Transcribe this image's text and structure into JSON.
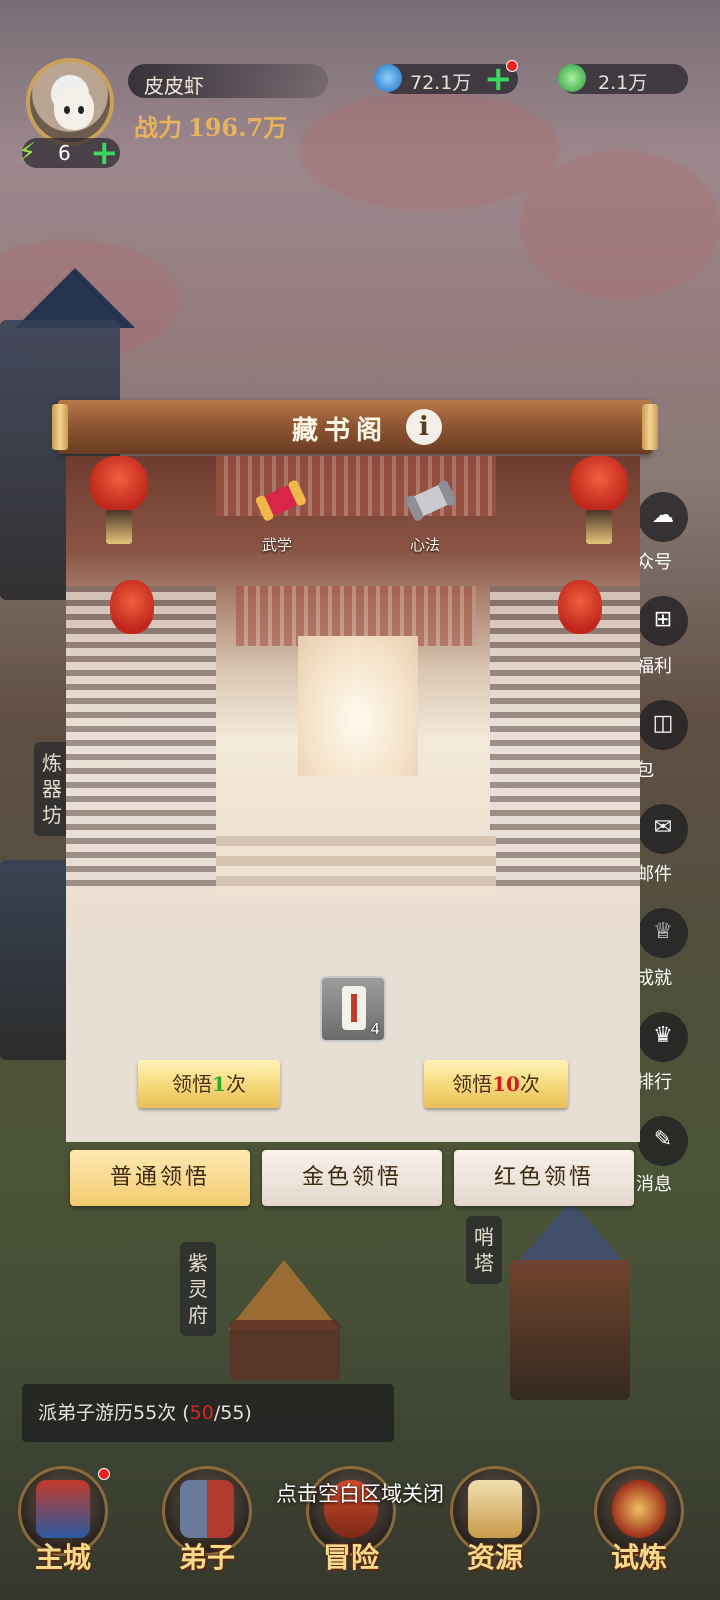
{
  "player": {
    "name": "皮皮虾",
    "power_label": "战力",
    "power_value": "196.7万",
    "energy": "6"
  },
  "resources": [
    {
      "icon": "blue-gem-icon",
      "value": "72.1万",
      "color": "#3aa0e8"
    },
    {
      "icon": "jade-coin-icon",
      "value": "2.1万",
      "color": "#3bbf4a"
    }
  ],
  "side_menu": [
    {
      "icon": "chat-icon",
      "label": "众号"
    },
    {
      "icon": "gift-icon",
      "label": "福利"
    },
    {
      "icon": "bag-icon",
      "label": "包"
    },
    {
      "icon": "mail-icon",
      "label": "邮件"
    },
    {
      "icon": "trophy-icon",
      "label": "成就"
    },
    {
      "icon": "crown-icon",
      "label": "排行"
    },
    {
      "icon": "message-icon",
      "label": "消息"
    }
  ],
  "buildings": {
    "left": "炼器坊",
    "purple": "紫灵府",
    "tower": "哨塔"
  },
  "modal": {
    "title": "藏书阁",
    "info_icon": "i",
    "categories": [
      {
        "icon": "red-scroll-icon",
        "label": "武学"
      },
      {
        "icon": "silver-scroll-icon",
        "label": "心法"
      }
    ],
    "item": {
      "icon": "scroll-item-icon",
      "count": "4"
    },
    "buttons": {
      "once": {
        "prefix": "领悟",
        "num": "1",
        "suffix": "次"
      },
      "ten": {
        "prefix": "领悟",
        "num": "10",
        "suffix": "次"
      }
    },
    "tabs": [
      "普通领悟",
      "金色领悟",
      "红色领悟"
    ]
  },
  "quest": {
    "text": "派弟子游历55次",
    "open": " (",
    "current": "50",
    "total": "/55)"
  },
  "close_hint": "点击空白区域关闭",
  "bottom_nav": [
    "主城",
    "弟子",
    "冒险",
    "资源",
    "试炼"
  ],
  "colors": {
    "accent_gold": "#f2cb6e",
    "title_brown": "#8f5733",
    "red": "#d31e1e",
    "green": "#2bab2b"
  }
}
